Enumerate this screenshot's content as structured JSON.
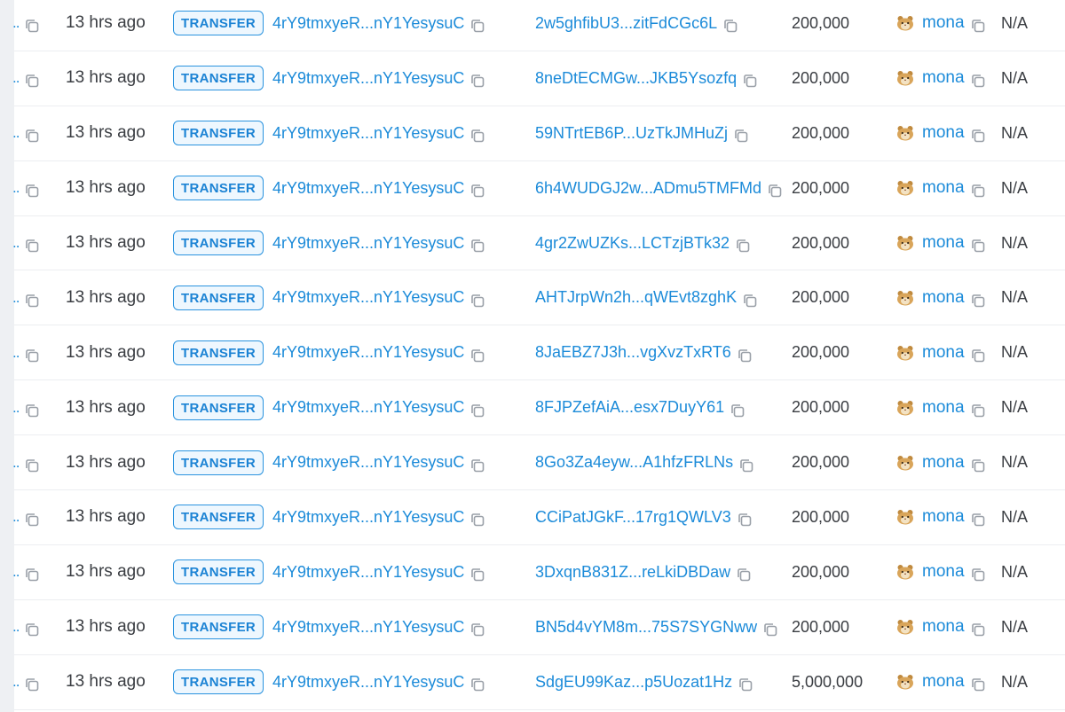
{
  "colors": {
    "link": "#1c8bd9",
    "badge_border": "#2a93df",
    "badge_bg": "#eef7fe",
    "text": "#3a3d42",
    "row_border": "#eceef1"
  },
  "icons": {
    "copy": "copy-icon",
    "token": "hamster-emoji-icon"
  },
  "truncated_signature": "..",
  "rows": [
    {
      "time": "13 hrs ago",
      "type": "TRANSFER",
      "from": "4rY9tmxyeR...nY1YesysuC",
      "to": "2w5ghfibU3...zitFdCGc6L",
      "amount": "200,000",
      "token": "mona",
      "extra": "N/A"
    },
    {
      "time": "13 hrs ago",
      "type": "TRANSFER",
      "from": "4rY9tmxyeR...nY1YesysuC",
      "to": "8neDtECMGw...JKB5Ysozfq",
      "amount": "200,000",
      "token": "mona",
      "extra": "N/A"
    },
    {
      "time": "13 hrs ago",
      "type": "TRANSFER",
      "from": "4rY9tmxyeR...nY1YesysuC",
      "to": "59NTrtEB6P...UzTkJMHuZj",
      "amount": "200,000",
      "token": "mona",
      "extra": "N/A"
    },
    {
      "time": "13 hrs ago",
      "type": "TRANSFER",
      "from": "4rY9tmxyeR...nY1YesysuC",
      "to": "6h4WUDGJ2w...ADmu5TMFMd",
      "amount": "200,000",
      "token": "mona",
      "extra": "N/A"
    },
    {
      "time": "13 hrs ago",
      "type": "TRANSFER",
      "from": "4rY9tmxyeR...nY1YesysuC",
      "to": "4gr2ZwUZKs...LCTzjBTk32",
      "amount": "200,000",
      "token": "mona",
      "extra": "N/A"
    },
    {
      "time": "13 hrs ago",
      "type": "TRANSFER",
      "from": "4rY9tmxyeR...nY1YesysuC",
      "to": "AHTJrpWn2h...qWEvt8zghK",
      "amount": "200,000",
      "token": "mona",
      "extra": "N/A"
    },
    {
      "time": "13 hrs ago",
      "type": "TRANSFER",
      "from": "4rY9tmxyeR...nY1YesysuC",
      "to": "8JaEBZ7J3h...vgXvzTxRT6",
      "amount": "200,000",
      "token": "mona",
      "extra": "N/A"
    },
    {
      "time": "13 hrs ago",
      "type": "TRANSFER",
      "from": "4rY9tmxyeR...nY1YesysuC",
      "to": "8FJPZefAiA...esx7DuyY61",
      "amount": "200,000",
      "token": "mona",
      "extra": "N/A"
    },
    {
      "time": "13 hrs ago",
      "type": "TRANSFER",
      "from": "4rY9tmxyeR...nY1YesysuC",
      "to": "8Go3Za4eyw...A1hfzFRLNs",
      "amount": "200,000",
      "token": "mona",
      "extra": "N/A"
    },
    {
      "time": "13 hrs ago",
      "type": "TRANSFER",
      "from": "4rY9tmxyeR...nY1YesysuC",
      "to": "CCiPatJGkF...17rg1QWLV3",
      "amount": "200,000",
      "token": "mona",
      "extra": "N/A"
    },
    {
      "time": "13 hrs ago",
      "type": "TRANSFER",
      "from": "4rY9tmxyeR...nY1YesysuC",
      "to": "3DxqnB831Z...reLkiDBDaw",
      "amount": "200,000",
      "token": "mona",
      "extra": "N/A"
    },
    {
      "time": "13 hrs ago",
      "type": "TRANSFER",
      "from": "4rY9tmxyeR...nY1YesysuC",
      "to": "BN5d4vYM8m...75S7SYGNww",
      "amount": "200,000",
      "token": "mona",
      "extra": "N/A"
    },
    {
      "time": "13 hrs ago",
      "type": "TRANSFER",
      "from": "4rY9tmxyeR...nY1YesysuC",
      "to": "SdgEU99Kaz...p5Uozat1Hz",
      "amount": "5,000,000",
      "token": "mona",
      "extra": "N/A"
    }
  ]
}
